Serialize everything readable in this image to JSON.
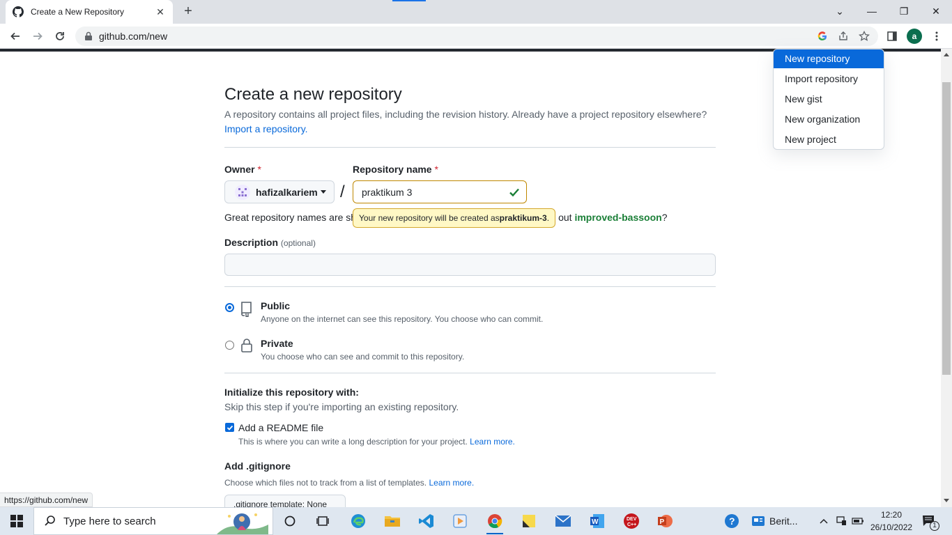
{
  "browser": {
    "tab_title": "Create a New Repository",
    "tab_close": "✕",
    "new_tab": "+",
    "url": "github.com/new",
    "window_controls": {
      "dropdown": "⌄",
      "minimize": "—",
      "restore": "❐",
      "close": "✕"
    },
    "profile_initial": "a",
    "status_url": "https://github.com/new"
  },
  "page": {
    "title": "Create a new repository",
    "lead": "A repository contains all project files, including the revision history. Already have a project repository elsewhere?",
    "import_link": "Import a repository.",
    "owner_label": "Owner",
    "required_mark": "*",
    "owner_value": "hafizalkariem",
    "separator": "/",
    "repo_name_label": "Repository name",
    "repo_name_value": "praktikum 3",
    "hint_prefix": "Great repository names are sh",
    "hint_suffix_plain": "out ",
    "hint_suggestion": "improved-bassoon",
    "hint_end": "?",
    "tooltip_prefix": "Your new repository will be created as ",
    "tooltip_name": "praktikum-3",
    "tooltip_end": ".",
    "description_label": "Description",
    "optional": "(optional)",
    "public_title": "Public",
    "public_sub": "Anyone on the internet can see this repository. You choose who can commit.",
    "private_title": "Private",
    "private_sub": "You choose who can see and commit to this repository.",
    "init_title": "Initialize this repository with:",
    "init_sub": "Skip this step if you're importing an existing repository.",
    "readme_label": "Add a README file",
    "readme_sub": "This is where you can write a long description for your project.",
    "learn_more": "Learn more.",
    "gitignore_label": "Add .gitignore",
    "gitignore_sub": "Choose which files not to track from a list of templates.",
    "gitignore_button": ".gitignore template: None"
  },
  "dropdown": {
    "items": [
      "New repository",
      "Import repository",
      "New gist",
      "New organization",
      "New project"
    ]
  },
  "taskbar": {
    "search_placeholder": "Type here to search",
    "weather": "Berit...",
    "time": "12:20",
    "date": "26/10/2022",
    "notifications": "1"
  },
  "colors": {
    "accent": "#0969da",
    "success": "#1a7f37",
    "danger": "#cf222e",
    "tooltip_bg": "#fff8c5"
  }
}
